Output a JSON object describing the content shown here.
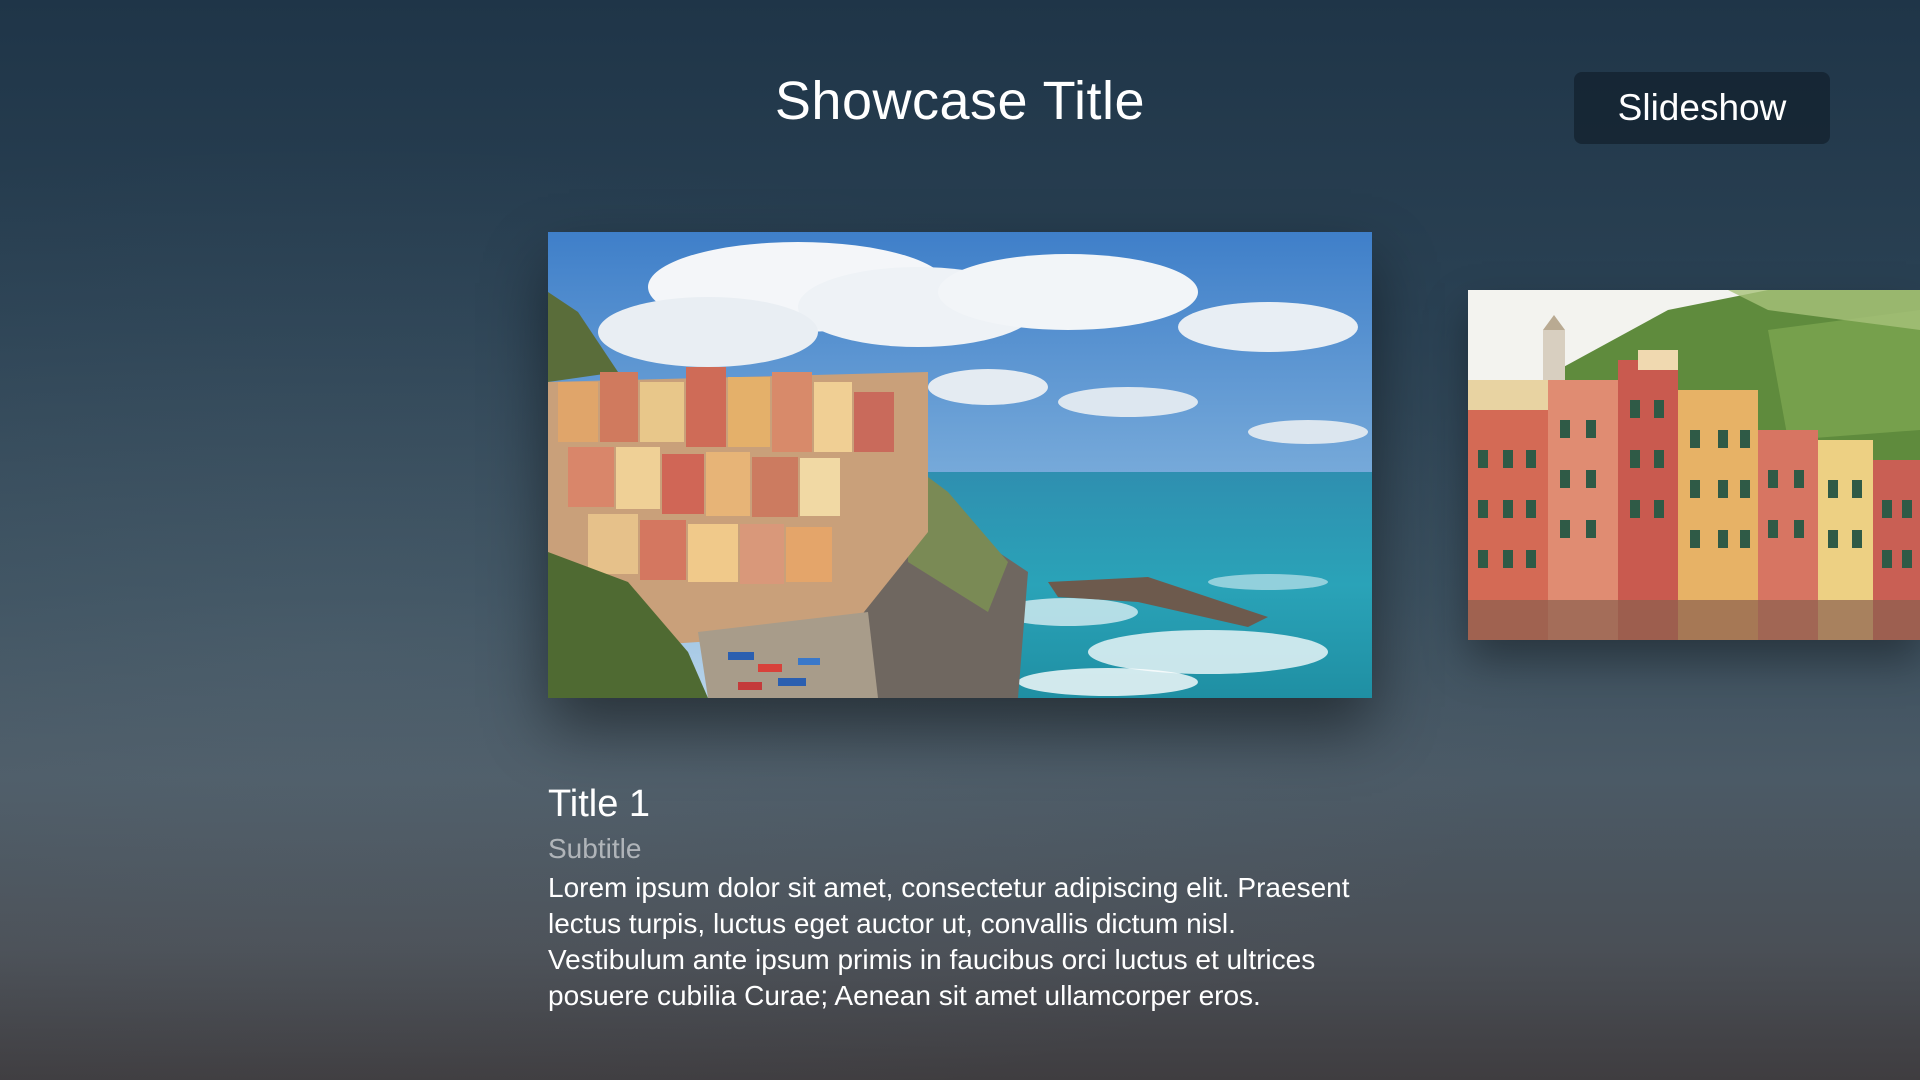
{
  "header": {
    "title": "Showcase Title",
    "slideshow_label": "Slideshow"
  },
  "carousel": {
    "items": [
      {
        "title": "Title 1",
        "subtitle": "Subtitle",
        "description": "Lorem ipsum dolor sit amet, consectetur adipiscing elit. Praesent lectus turpis, luctus eget auctor ut, convallis dictum nisl. Vestibulum ante ipsum primis in faucibus orci luctus et ultrices posuere cubilia Curae; Aenean sit amet ullamcorper eros.",
        "focused": true
      }
    ]
  },
  "colors": {
    "background_top": "#1f3548",
    "background_bottom": "#3f3d40",
    "button_bg": "#12202d",
    "subtitle_text": "#9aa3ab"
  }
}
